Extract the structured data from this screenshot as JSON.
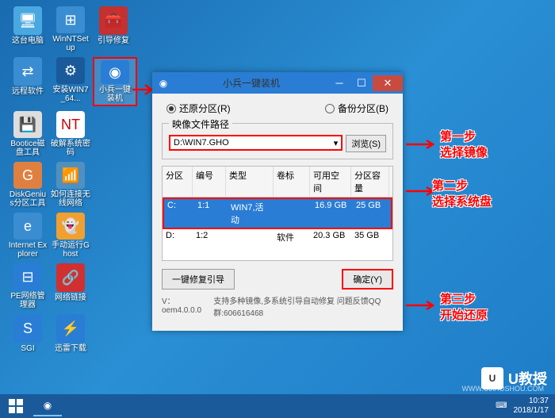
{
  "desktop": {
    "icons": [
      [
        {
          "label": "这台电脑",
          "bg": "#4aa8e0"
        },
        {
          "label": "WinNTSetup",
          "bg": "#3a8dd0"
        },
        {
          "label": "引导修复",
          "bg": "#c53030"
        }
      ],
      [
        {
          "label": "远程软件",
          "bg": "#3a8dd0"
        },
        {
          "label": "安装WIN7_64...",
          "bg": "#1a5a9a"
        },
        {
          "label": "小兵一键装机",
          "bg": "#2a7dd4",
          "highlight": true
        }
      ],
      [
        {
          "label": "Bootice磁盘工具",
          "bg": "#888"
        },
        {
          "label": "破解系统密码",
          "bg": "#fff"
        }
      ],
      [
        {
          "label": "DiskGenius分区工具",
          "bg": "#e08040"
        },
        {
          "label": "如何连接无线网络",
          "bg": "#5090c0"
        }
      ],
      [
        {
          "label": "Internet Explorer",
          "bg": "#3a8dd0"
        },
        {
          "label": "手动运行Ghost",
          "bg": "#f0a030"
        }
      ],
      [
        {
          "label": "PE网络管理器",
          "bg": "#2a7dd4"
        },
        {
          "label": "网络链接",
          "bg": "#d03030"
        }
      ],
      [
        {
          "label": "SGI",
          "bg": "#2a7dd4"
        },
        {
          "label": "迅雷下载",
          "bg": "#2a7dd4"
        }
      ]
    ]
  },
  "window": {
    "title": "小兵一键装机",
    "radio": {
      "restore": "还原分区(R)",
      "backup": "备份分区(B)"
    },
    "pathGroup": "映像文件路径",
    "pathValue": "D:\\WIN7.GHO",
    "browse": "浏览(S)",
    "table": {
      "headers": {
        "part": "分区",
        "num": "编号",
        "type": "类型",
        "label": "卷标",
        "free": "可用空间",
        "size": "分区容量"
      },
      "rows": [
        {
          "part": "C:",
          "num": "1:1",
          "type": "WIN7,活动",
          "label": "",
          "free": "16.9 GB",
          "size": "25 GB",
          "selected": true
        },
        {
          "part": "D:",
          "num": "1:2",
          "type": "",
          "label": "软件",
          "free": "20.3 GB",
          "size": "35 GB",
          "selected": false
        }
      ]
    },
    "repairBtn": "一键修复引导",
    "okBtn": "确定(Y)",
    "status": {
      "version": "V：oem4.0.0.0",
      "info": "支持多种镜像,多系统引导自动修复  问题反馈QQ群:606616468"
    }
  },
  "annotations": {
    "step1a": "第一步",
    "step1b": "选择镜像",
    "step2a": "第二步",
    "step2b": "选择系统盘",
    "step3a": "第三步",
    "step3b": "开始还原"
  },
  "tray": {
    "time": "10:37",
    "date": "2018/1/17"
  },
  "watermark": {
    "brand": "U教授",
    "sub": "WWW.UJIAOSHOU.COM"
  }
}
